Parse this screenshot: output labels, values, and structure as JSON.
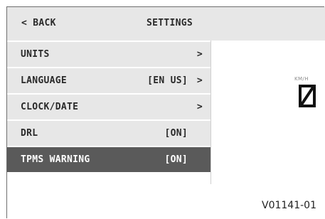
{
  "header": {
    "back_label": "< BACK",
    "title": "SETTINGS"
  },
  "menu": {
    "items": [
      {
        "label": "UNITS",
        "value": "",
        "chevron": ">"
      },
      {
        "label": "LANGUAGE",
        "value": "[EN US]",
        "chevron": ">"
      },
      {
        "label": "CLOCK/DATE",
        "value": "",
        "chevron": ">"
      },
      {
        "label": "DRL",
        "value": "[ON]",
        "chevron": ""
      },
      {
        "label": "TPMS WARNING",
        "value": "[ON]",
        "chevron": ""
      }
    ]
  },
  "speed": {
    "unit": "KM/H",
    "digit_icon": "zero-digit-icon"
  },
  "figure_code": "V01141-01",
  "colors": {
    "panel": "#e7e7e7",
    "selected": "#5a5a5a",
    "text": "#2a2a2a"
  }
}
